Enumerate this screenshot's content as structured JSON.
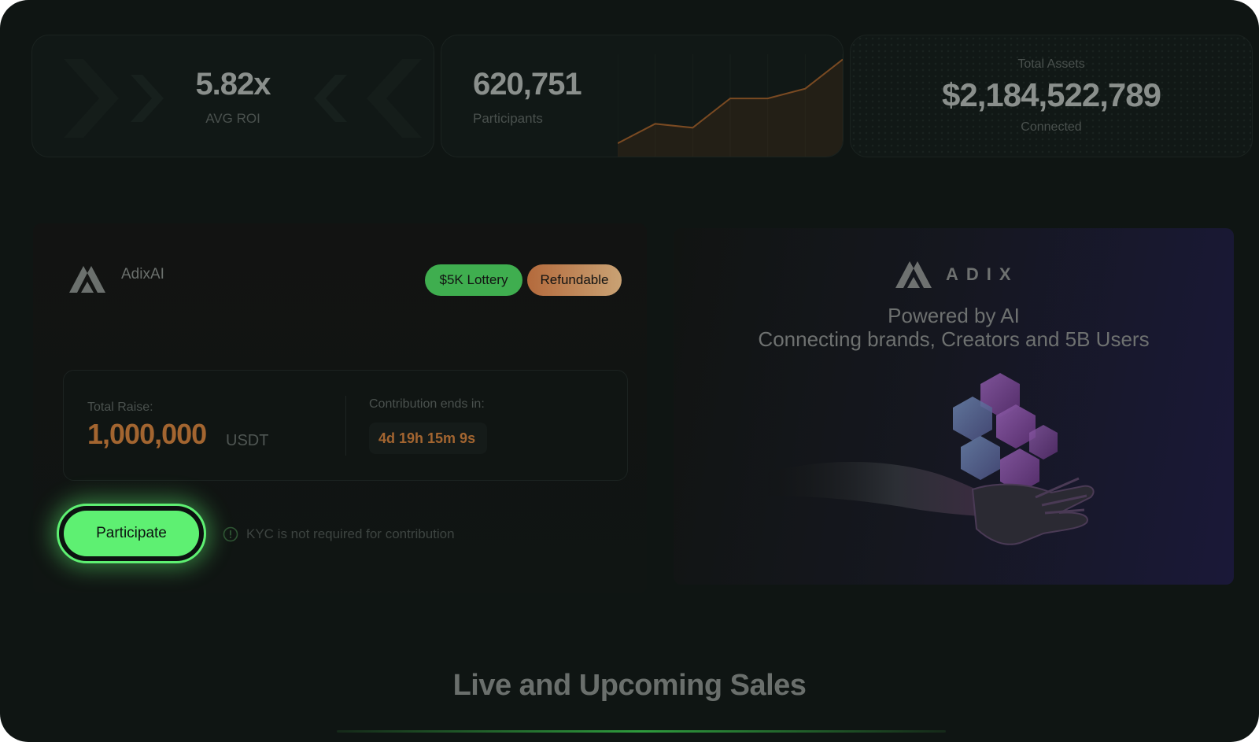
{
  "stats": {
    "roi": {
      "value": "5.82x",
      "label": "AVG ROI"
    },
    "participants": {
      "value": "620,751",
      "label": "Participants",
      "trend": [
        0.12,
        0.32,
        0.28,
        0.58,
        0.58,
        0.68,
        0.98
      ]
    },
    "assets": {
      "caption": "Total Assets",
      "value": "$2,184,522,789",
      "label": "Connected"
    }
  },
  "project": {
    "name": "AdixAI",
    "logo_icon": "adix-logo-icon",
    "badges": [
      {
        "label": "$5K Lottery",
        "color": "#3fae4f"
      },
      {
        "label": "Refundable",
        "color": "#c07a4a"
      }
    ],
    "raise": {
      "label": "Total Raise:",
      "amount": "1,000,000",
      "currency": "USDT"
    },
    "contribution": {
      "label": "Contribution ends in:",
      "countdown": "4d 19h 15m 9s"
    },
    "participate_label": "Participate",
    "kyc_note": "KYC is not required for contribution"
  },
  "promo": {
    "brand": "ADIX",
    "line1": "Powered by AI",
    "line2": "Connecting brands, Creators and 5B Users"
  },
  "section": {
    "title": "Live and Upcoming Sales"
  },
  "colors": {
    "accent": "#5ef072",
    "orange": "#c9783c",
    "background": "#0f1513"
  }
}
